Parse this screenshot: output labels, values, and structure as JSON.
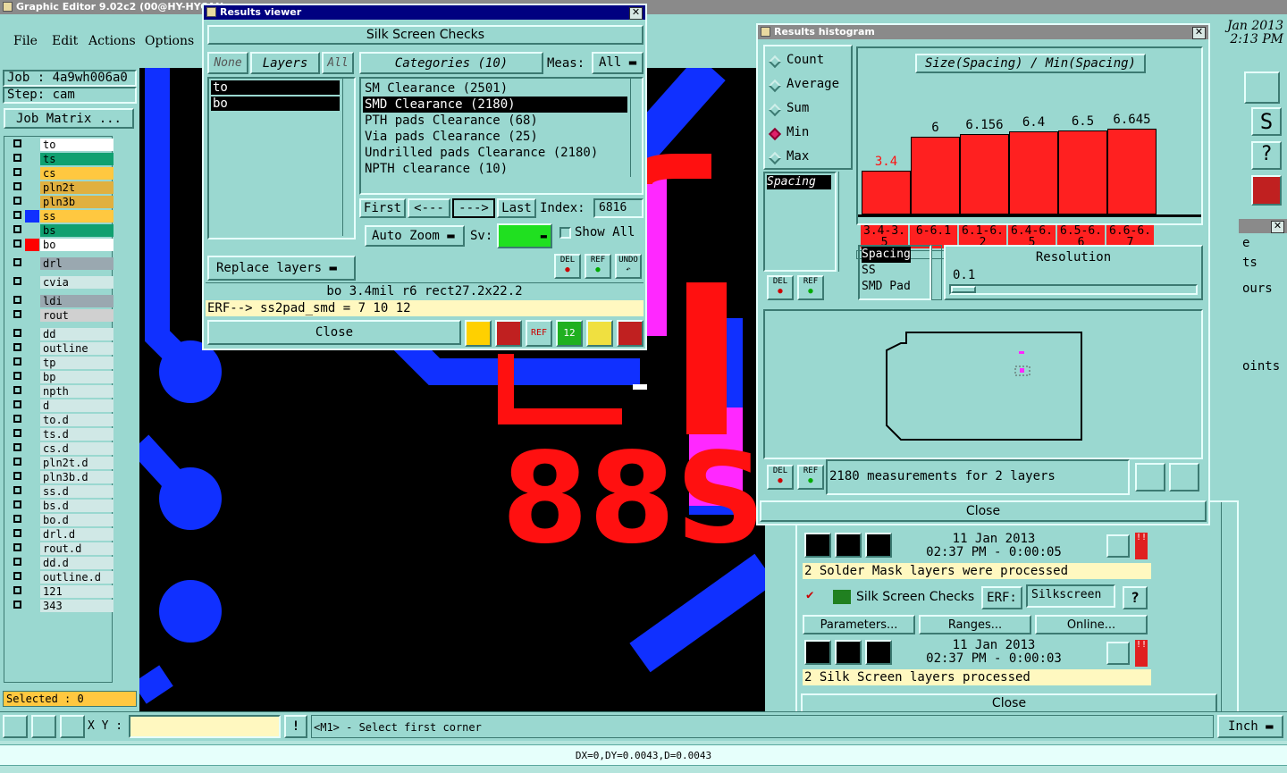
{
  "main_window": {
    "title": "Graphic Editor 9.02c2 (00@HY-HYCAN",
    "menu": [
      "File",
      "Edit",
      "Actions",
      "Options"
    ],
    "date": "Jan 2013",
    "time": "2:13 PM"
  },
  "left_panel": {
    "job_label": "Job : 4a9wh006a0",
    "step_label": "Step: cam",
    "job_matrix_button": "Job Matrix ...",
    "selected_label": "Selected : 0",
    "layers": [
      {
        "name": "to",
        "color": "#ffffff"
      },
      {
        "name": "ts",
        "color": "#10a070"
      },
      {
        "name": "cs",
        "color": "#ffc840"
      },
      {
        "name": "pln2t",
        "color": "#e0b040"
      },
      {
        "name": "pln3b",
        "color": "#e0b040"
      },
      {
        "name": "ss",
        "color": "#ffc840",
        "swatch": "#1030ff"
      },
      {
        "name": "bs",
        "color": "#10a070"
      },
      {
        "name": "bo",
        "color": "#ffffff",
        "swatch": "#ff0000"
      },
      {
        "name": "drl",
        "color": "#9aa8b0"
      },
      {
        "name": "cvia",
        "color": "#d0e8e6"
      },
      {
        "name": "ldi",
        "color": "#9aa8b0"
      },
      {
        "name": "rout",
        "color": "#d0d0d0"
      },
      {
        "name": "dd",
        "color": "#d0e8e6"
      },
      {
        "name": "outline",
        "color": "#d0e8e6"
      },
      {
        "name": "tp",
        "color": "#d0e8e6"
      },
      {
        "name": "bp",
        "color": "#d0e8e6"
      },
      {
        "name": "npth",
        "color": "#d0e8e6"
      },
      {
        "name": "d",
        "color": "#d0e8e6"
      },
      {
        "name": "to.d",
        "color": "#d0e8e6"
      },
      {
        "name": "ts.d",
        "color": "#d0e8e6"
      },
      {
        "name": "cs.d",
        "color": "#d0e8e6"
      },
      {
        "name": "pln2t.d",
        "color": "#d0e8e6"
      },
      {
        "name": "pln3b.d",
        "color": "#d0e8e6"
      },
      {
        "name": "ss.d",
        "color": "#d0e8e6"
      },
      {
        "name": "bs.d",
        "color": "#d0e8e6"
      },
      {
        "name": "bo.d",
        "color": "#d0e8e6"
      },
      {
        "name": "drl.d",
        "color": "#d0e8e6"
      },
      {
        "name": "rout.d",
        "color": "#d0e8e6"
      },
      {
        "name": "dd.d",
        "color": "#d0e8e6"
      },
      {
        "name": "outline.d",
        "color": "#d0e8e6"
      },
      {
        "name": "121",
        "color": "#d0e8e6"
      },
      {
        "name": "343",
        "color": "#d0e8e6"
      }
    ]
  },
  "results_viewer": {
    "title": "Results viewer",
    "header": "Silk Screen Checks",
    "none_btn": "None",
    "layers_btn": "Layers",
    "all_btn": "All",
    "categories_btn": "Categories  (10)",
    "meas_label": "Meas:",
    "meas_value": "All",
    "layers_list": [
      "to",
      "bo"
    ],
    "categories": [
      "SM Clearance  (2501)",
      "SMD Clearance  (2180)",
      "PTH pads Clearance  (68)",
      "Via pads Clearance  (25)",
      "Undrilled pads Clearance  (2180)",
      "NPTH clearance  (10)"
    ],
    "first_btn": "First",
    "prev_btn": "<---",
    "next_btn": "--->",
    "last_btn": "Last",
    "index_label": "Index:",
    "index_value": "6816",
    "auto_zoom": "Auto  Zoom",
    "sv_label": "Sv:",
    "show_all": "Show  All",
    "replace_layers": "Replace layers",
    "del": "DEL",
    "ref": "REF",
    "undo": "UNDO",
    "status_line": "bo 3.4mil   r6   rect27.2x22.2",
    "erf_line": "ERF--> ss2pad_smd = 7 10 12",
    "close": "Close"
  },
  "results_histogram": {
    "title": "Results histogram",
    "modes": [
      "Count",
      "Average",
      "Sum",
      "Min",
      "Max"
    ],
    "selected_mode": "Min",
    "chart_title": "Size(Spacing) / Min(Spacing)",
    "list_item": "Spacing",
    "bars": [
      {
        "value": "3.4",
        "bin": "3.4-3.5",
        "fill": 0.45
      },
      {
        "value": "6",
        "bin": "6-6.1",
        "fill": 0.81
      },
      {
        "value": "6.156",
        "bin": "6.1-6.2",
        "fill": 0.83
      },
      {
        "value": "6.4",
        "bin": "6.4-6.5",
        "fill": 0.86
      },
      {
        "value": "6.5",
        "bin": "6.5-6.6",
        "fill": 0.87
      },
      {
        "value": "6.645",
        "bin": "6.6-6.7",
        "fill": 0.89
      }
    ],
    "attr_list": [
      "Spacing",
      "SS",
      "SMD Pad"
    ],
    "resolution_label": "Resolution",
    "resolution_value": "0.1",
    "measurements": "2180 measurements for 2 layers",
    "close": "Close"
  },
  "checklist": {
    "date1": "11 Jan 2013",
    "time1": "02:37 PM - 0:00:05",
    "msg1": "2 Solder Mask layers were processed",
    "check_name": "Silk Screen Checks",
    "erf_label": "ERF:",
    "erf_value": "Silkscreen",
    "help": "?",
    "params": "Parameters...",
    "ranges": "Ranges...",
    "online": "Online...",
    "date2": "11 Jan 2013",
    "time2": "02:37 PM - 0:00:03",
    "msg2": "2 Silk Screen layers processed",
    "close": "Close"
  },
  "right_strip": {
    "partial": [
      "e",
      "ts",
      "ours",
      "oints"
    ]
  },
  "bottom": {
    "xy_label": "X Y :",
    "prompt": "<M1> - Select first corner",
    "units": "Inch",
    "status": "DX=0,DY=0.0043,D=0.0043"
  },
  "canvas": {
    "label_text": "88S"
  }
}
